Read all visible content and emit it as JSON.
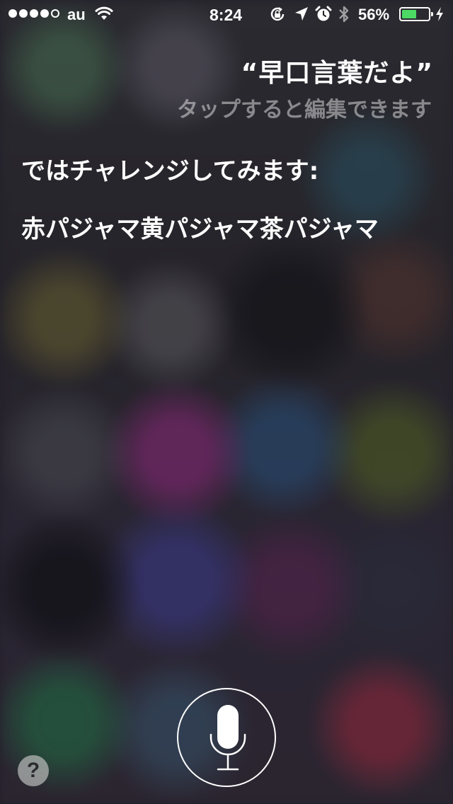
{
  "status_bar": {
    "signal_bars_filled": 4,
    "signal_bars_total": 5,
    "carrier": "au",
    "time": "8:24",
    "battery_percent_text": "56%",
    "battery_level": 0.56,
    "battery_color": "#4cd964",
    "icons": [
      "wifi-icon",
      "rotation-lock-icon",
      "location-icon",
      "alarm-icon",
      "bluetooth-icon",
      "charging-icon"
    ]
  },
  "siri": {
    "user_utterance": "“早口言葉だよ”",
    "edit_hint": "タップすると編集できます",
    "response": "ではチャレンジしてみます:",
    "tongue_twister": "赤パジャマ黄パジャマ茶パジャマ"
  },
  "controls": {
    "mic_icon": "microphone-icon",
    "help_label": "?"
  }
}
